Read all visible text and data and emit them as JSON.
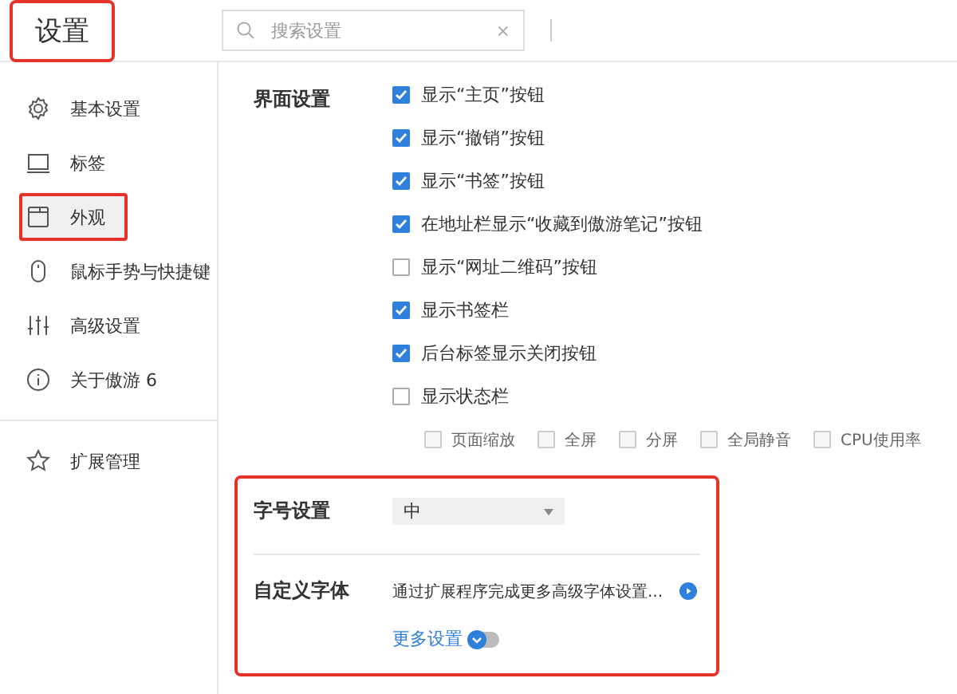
{
  "header": {
    "title": "设置",
    "highlighted": true,
    "search": {
      "placeholder": "搜索设置",
      "clear": "×"
    }
  },
  "sidebar": {
    "items": [
      {
        "label": "基本设置",
        "selected": false,
        "highlighted": false
      },
      {
        "label": "标签",
        "selected": false,
        "highlighted": false
      },
      {
        "label": "外观",
        "selected": true,
        "highlighted": true
      },
      {
        "label": "鼠标手势与快捷键",
        "selected": false,
        "highlighted": false
      },
      {
        "label": "高级设置",
        "selected": false,
        "highlighted": false
      },
      {
        "label": "关于傲游 6",
        "selected": false,
        "highlighted": false
      }
    ],
    "footer_items": [
      {
        "label": "扩展管理",
        "selected": false,
        "highlighted": false
      }
    ]
  },
  "interface_section": {
    "label": "界面设置",
    "options": [
      {
        "label": "显示“主页”按钮",
        "checked": true
      },
      {
        "label": "显示“撤销”按钮",
        "checked": true
      },
      {
        "label": "显示“书签”按钮",
        "checked": true
      },
      {
        "label": "在地址栏显示“收藏到傲游笔记”按钮",
        "checked": true
      },
      {
        "label": "显示“网址二维码”按钮",
        "checked": false
      },
      {
        "label": "显示书签栏",
        "checked": true
      },
      {
        "label": "后台标签显示关闭按钮",
        "checked": true
      },
      {
        "label": "显示状态栏",
        "checked": false
      }
    ],
    "status_bar_options": [
      {
        "label": "页面缩放",
        "checked": false,
        "disabled": true
      },
      {
        "label": "全屏",
        "checked": false,
        "disabled": true
      },
      {
        "label": "分屏",
        "checked": false,
        "disabled": true
      },
      {
        "label": "全局静音",
        "checked": false,
        "disabled": true
      },
      {
        "label": "CPU使用率",
        "checked": false,
        "disabled": true
      }
    ]
  },
  "font_section": {
    "highlighted": true,
    "font_size": {
      "label": "字号设置",
      "value": "中"
    },
    "custom_font": {
      "label": "自定义字体",
      "description": "通过扩展程序完成更多高级字体设置...",
      "more_link": "更多设置",
      "more_expanded": false
    }
  }
}
